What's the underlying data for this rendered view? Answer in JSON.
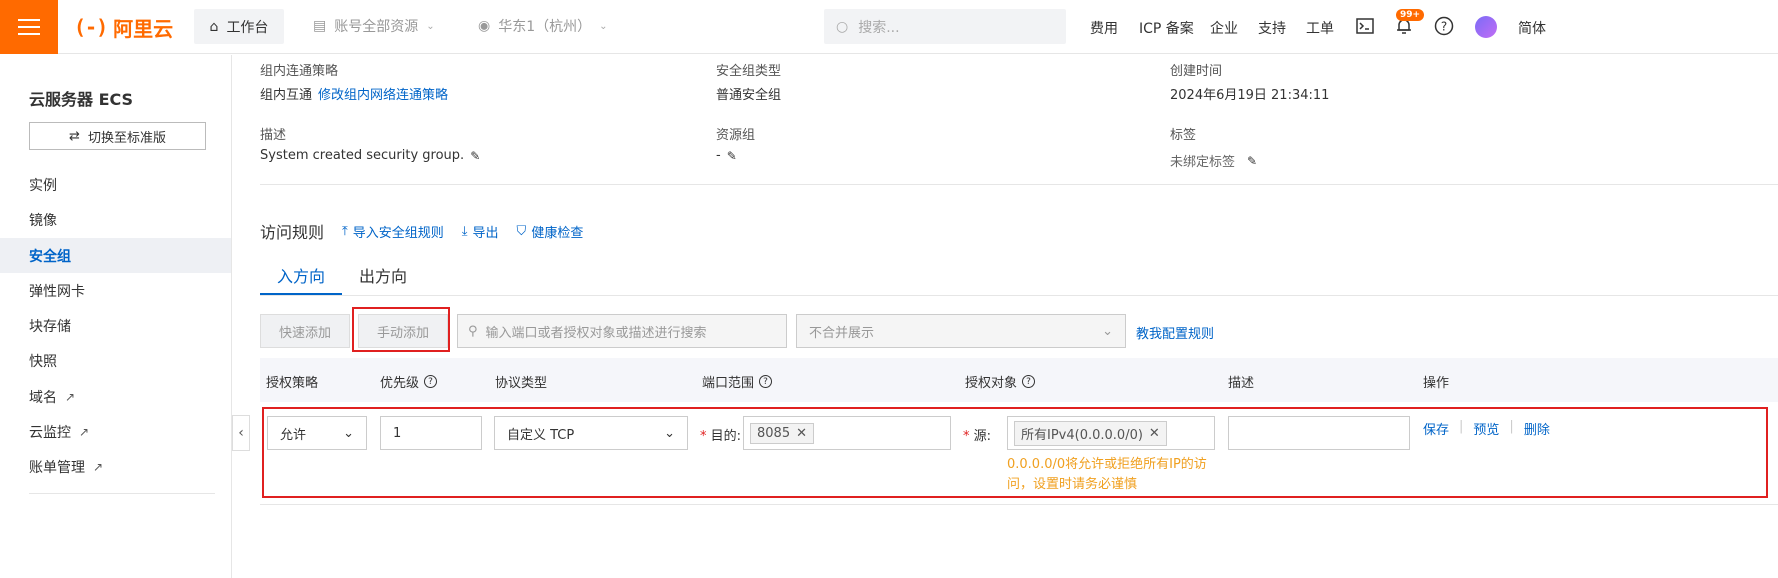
{
  "topbar": {
    "logo_text": "阿里云",
    "logo_mark": "(-)",
    "home_label": "工作台",
    "account_dropdown": "账号全部资源",
    "region_dropdown": "华东1（杭州）",
    "search_placeholder": "搜索...",
    "links": [
      "费用",
      "ICP 备案",
      "企业",
      "支持",
      "工单"
    ],
    "notification_count": "99+",
    "lang": "简体",
    "brand_color": "#ff6a00"
  },
  "sidebar": {
    "title": "云服务器 ECS",
    "switch_label": "切换至标准版",
    "items": [
      {
        "label": "实例"
      },
      {
        "label": "镜像"
      },
      {
        "label": "安全组",
        "active": true
      },
      {
        "label": "弹性网卡"
      },
      {
        "label": "块存储"
      },
      {
        "label": "快照"
      },
      {
        "label": "域名",
        "external": true
      },
      {
        "label": "云监控",
        "external": true
      },
      {
        "label": "账单管理",
        "external": true
      }
    ]
  },
  "info": {
    "intra_policy_label": "组内连通策略",
    "intra_policy_value": "组内互通",
    "intra_policy_link": "修改组内网络连通策略",
    "sg_type_label": "安全组类型",
    "sg_type_value": "普通安全组",
    "created_label": "创建时间",
    "created_value": "2024年6月19日 21:34:11",
    "desc_label": "描述",
    "desc_value": "System created security group.",
    "rg_label": "资源组",
    "rg_value": "-",
    "tag_label": "标签",
    "tag_value": "未绑定标签"
  },
  "rules": {
    "title": "访问规则",
    "import_link": "导入安全组规则",
    "export_link": "导出",
    "health_link": "健康检查",
    "tabs": [
      "入方向",
      "出方向"
    ],
    "quick_add": "快速添加",
    "manual_add": "手动添加",
    "search_placeholder": "输入端口或者授权对象或描述进行搜索",
    "merge_select": "不合并展示",
    "guide_link": "教我配置规则",
    "columns": [
      "授权策略",
      "优先级",
      "协议类型",
      "端口范围",
      "授权对象",
      "描述",
      "操作"
    ],
    "row": {
      "policy": "允许",
      "priority": "1",
      "protocol": "自定义 TCP",
      "dest_label": "目的:",
      "port_tag": "8085",
      "src_label": "源:",
      "src_tag": "所有IPv4(0.0.0.0/0)",
      "warning": "0.0.0.0/0将允许或拒绝所有IP的访问，设置时请务必谨慎",
      "ops": [
        "保存",
        "预览",
        "删除"
      ]
    }
  },
  "colors": {
    "link": "#0064c8",
    "highlight": "#e02020",
    "warning": "#f0a020"
  }
}
